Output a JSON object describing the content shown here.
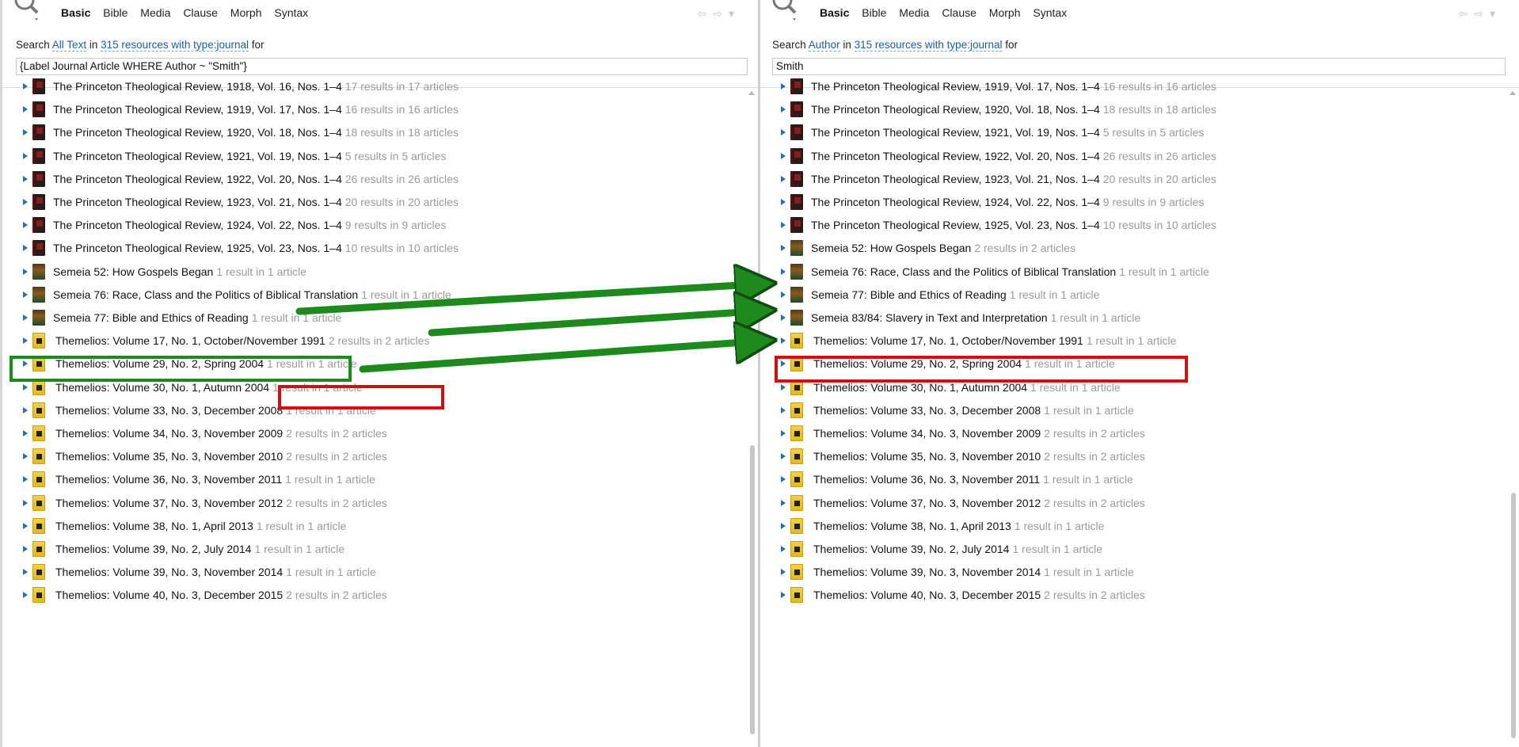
{
  "toolbar": {
    "menu": [
      "Basic",
      "Bible",
      "Media",
      "Clause",
      "Morph",
      "Syntax"
    ]
  },
  "left": {
    "search_prefix": "Search",
    "search_field": "All Text",
    "in_label": "in",
    "resources": "315 resources with type:journal",
    "for_label": "for",
    "query": "{Label Journal Article WHERE Author ~ \"Smith\"}",
    "results": [
      {
        "kind": "princeton",
        "title": "The Princeton Theological Review, 1918, Vol. 16, Nos. 1–4",
        "count": "17 results in 17 articles"
      },
      {
        "kind": "princeton",
        "title": "The Princeton Theological Review, 1919, Vol. 17, Nos. 1–4",
        "count": "16 results in 16 articles"
      },
      {
        "kind": "princeton",
        "title": "The Princeton Theological Review, 1920, Vol. 18, Nos. 1–4",
        "count": "18 results in 18 articles"
      },
      {
        "kind": "princeton",
        "title": "The Princeton Theological Review, 1921, Vol. 19, Nos. 1–4",
        "count": "5 results in 5 articles"
      },
      {
        "kind": "princeton",
        "title": "The Princeton Theological Review, 1922, Vol. 20, Nos. 1–4",
        "count": "26 results in 26 articles"
      },
      {
        "kind": "princeton",
        "title": "The Princeton Theological Review, 1923, Vol. 21, Nos. 1–4",
        "count": "20 results in 20 articles"
      },
      {
        "kind": "princeton",
        "title": "The Princeton Theological Review, 1924, Vol. 22, Nos. 1–4",
        "count": "9 results in 9 articles"
      },
      {
        "kind": "princeton",
        "title": "The Princeton Theological Review, 1925, Vol. 23, Nos. 1–4",
        "count": "10 results in 10 articles"
      },
      {
        "kind": "semeia",
        "title": "Semeia 52: How Gospels Began",
        "count": "1 result in 1 article"
      },
      {
        "kind": "semeia",
        "title": "Semeia 76: Race, Class and the Politics of Biblical Translation",
        "count": "1 result in 1 article"
      },
      {
        "kind": "semeia",
        "title": "Semeia 77: Bible and Ethics of Reading",
        "count": "1 result in 1 article"
      },
      {
        "kind": "themelios",
        "title": "Themelios: Volume 17, No. 1, October/November 1991",
        "count": "2 results in 2 articles"
      },
      {
        "kind": "themelios",
        "title": "Themelios: Volume 29, No. 2, Spring 2004",
        "count": "1 result in 1 article"
      },
      {
        "kind": "themelios",
        "title": "Themelios: Volume 30, No. 1, Autumn 2004",
        "count": "1 result in 1 article"
      },
      {
        "kind": "themelios",
        "title": "Themelios: Volume 33, No. 3, December 2008",
        "count": "1 result in 1 article"
      },
      {
        "kind": "themelios",
        "title": "Themelios: Volume 34, No. 3, November 2009",
        "count": "2 results in 2 articles"
      },
      {
        "kind": "themelios",
        "title": "Themelios: Volume 35, No. 3, November 2010",
        "count": "2 results in 2 articles"
      },
      {
        "kind": "themelios",
        "title": "Themelios: Volume 36, No. 3, November 2011",
        "count": "1 result in 1 article"
      },
      {
        "kind": "themelios",
        "title": "Themelios: Volume 37, No. 3, November 2012",
        "count": "2 results in 2 articles"
      },
      {
        "kind": "themelios",
        "title": "Themelios: Volume 38, No. 1, April 2013",
        "count": "1 result in 1 article"
      },
      {
        "kind": "themelios",
        "title": "Themelios: Volume 39, No. 2, July 2014",
        "count": "1 result in 1 article"
      },
      {
        "kind": "themelios",
        "title": "Themelios: Volume 39, No. 3, November 2014",
        "count": "1 result in 1 article"
      },
      {
        "kind": "themelios",
        "title": "Themelios: Volume 40, No. 3, December 2015",
        "count": "2 results in 2 articles"
      }
    ]
  },
  "right": {
    "search_prefix": "Search",
    "search_field": "Author",
    "in_label": "in",
    "resources": "315 resources with type:journal",
    "for_label": "for",
    "query": "Smith",
    "results": [
      {
        "kind": "princeton",
        "title": "The Princeton Theological Review, 1919, Vol. 17, Nos. 1–4",
        "count": "16 results in 16 articles"
      },
      {
        "kind": "princeton",
        "title": "The Princeton Theological Review, 1920, Vol. 18, Nos. 1–4",
        "count": "18 results in 18 articles"
      },
      {
        "kind": "princeton",
        "title": "The Princeton Theological Review, 1921, Vol. 19, Nos. 1–4",
        "count": "5 results in 5 articles"
      },
      {
        "kind": "princeton",
        "title": "The Princeton Theological Review, 1922, Vol. 20, Nos. 1–4",
        "count": "26 results in 26 articles"
      },
      {
        "kind": "princeton",
        "title": "The Princeton Theological Review, 1923, Vol. 21, Nos. 1–4",
        "count": "20 results in 20 articles"
      },
      {
        "kind": "princeton",
        "title": "The Princeton Theological Review, 1924, Vol. 22, Nos. 1–4",
        "count": "9 results in 9 articles"
      },
      {
        "kind": "princeton",
        "title": "The Princeton Theological Review, 1925, Vol. 23, Nos. 1–4",
        "count": "10 results in 10 articles"
      },
      {
        "kind": "semeia",
        "title": "Semeia 52: How Gospels Began",
        "count": "2 results in 2 articles"
      },
      {
        "kind": "semeia",
        "title": "Semeia 76: Race, Class and the Politics of Biblical Translation",
        "count": "1 result in 1 article"
      },
      {
        "kind": "semeia",
        "title": "Semeia 77: Bible and Ethics of Reading",
        "count": "1 result in 1 article"
      },
      {
        "kind": "semeia",
        "title": "Semeia 83/84: Slavery in Text and Interpretation",
        "count": "1 result in 1 article"
      },
      {
        "kind": "themelios",
        "title": "Themelios: Volume 17, No. 1, October/November 1991",
        "count": "1 result in 1 article"
      },
      {
        "kind": "themelios",
        "title": "Themelios: Volume 29, No. 2, Spring 2004",
        "count": "1 result in 1 article"
      },
      {
        "kind": "themelios",
        "title": "Themelios: Volume 30, No. 1, Autumn 2004",
        "count": "1 result in 1 article"
      },
      {
        "kind": "themelios",
        "title": "Themelios: Volume 33, No. 3, December 2008",
        "count": "1 result in 1 article"
      },
      {
        "kind": "themelios",
        "title": "Themelios: Volume 34, No. 3, November 2009",
        "count": "2 results in 2 articles"
      },
      {
        "kind": "themelios",
        "title": "Themelios: Volume 35, No. 3, November 2010",
        "count": "2 results in 2 articles"
      },
      {
        "kind": "themelios",
        "title": "Themelios: Volume 36, No. 3, November 2011",
        "count": "1 result in 1 article"
      },
      {
        "kind": "themelios",
        "title": "Themelios: Volume 37, No. 3, November 2012",
        "count": "2 results in 2 articles"
      },
      {
        "kind": "themelios",
        "title": "Themelios: Volume 38, No. 1, April 2013",
        "count": "1 result in 1 article"
      },
      {
        "kind": "themelios",
        "title": "Themelios: Volume 39, No. 2, July 2014",
        "count": "1 result in 1 article"
      },
      {
        "kind": "themelios",
        "title": "Themelios: Volume 39, No. 3, November 2014",
        "count": "1 result in 1 article"
      },
      {
        "kind": "themelios",
        "title": "Themelios: Volume 40, No. 3, December 2015",
        "count": "2 results in 2 articles"
      }
    ]
  },
  "annotations": {
    "arrow_color": "#1e8a1e",
    "highlight_green": "#1e8a1e",
    "highlight_red": "#d01010"
  }
}
